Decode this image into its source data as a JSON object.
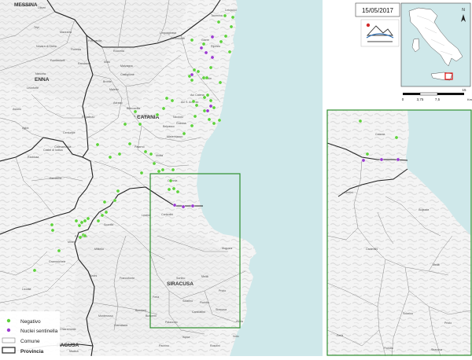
{
  "date": "15/05/2017",
  "provinces": [
    "MESSINA",
    "ENNA",
    "CATANIA",
    "SIRACUSA",
    "RAGUSA"
  ],
  "scalebar": {
    "ticks": [
      "0",
      "3,75",
      "7,5",
      "15"
    ],
    "unit": "Km"
  },
  "legend": {
    "negativo": "Negativo",
    "nuclei": "Nuclei sentinella",
    "comune": "Comune",
    "provincia": "Provincia"
  },
  "colors": {
    "negativo": "#5ed13c",
    "nuclei": "#9b3bd1",
    "sea": "#cfe8ea",
    "frame": "#2f8f2f",
    "province_border": "#222222",
    "comune_border": "#777777",
    "inset_highlight": "#e01010"
  },
  "icons": [
    "north-arrow-icon",
    "logo-icon"
  ],
  "main_points": {
    "negativo": [
      [
        286,
        20
      ],
      [
        296,
        22
      ],
      [
        278,
        28
      ],
      [
        294,
        34
      ],
      [
        287,
        46
      ],
      [
        281,
        53
      ],
      [
        292,
        66
      ],
      [
        244,
        51
      ],
      [
        259,
        56
      ],
      [
        247,
        89
      ],
      [
        252,
        91
      ],
      [
        241,
        97
      ],
      [
        259,
        99
      ],
      [
        263,
        99
      ],
      [
        244,
        102
      ],
      [
        268,
        86
      ],
      [
        280,
        105
      ],
      [
        264,
        121
      ],
      [
        268,
        128
      ],
      [
        250,
        134
      ],
      [
        260,
        124
      ],
      [
        246,
        129
      ],
      [
        272,
        137
      ],
      [
        260,
        141
      ],
      [
        248,
        148
      ],
      [
        266,
        152
      ],
      [
        279,
        153
      ],
      [
        272,
        157
      ],
      [
        244,
        160
      ],
      [
        234,
        170
      ],
      [
        219,
        128
      ],
      [
        208,
        138
      ],
      [
        200,
        146
      ],
      [
        212,
        125
      ],
      [
        172,
        142
      ],
      [
        178,
        158
      ],
      [
        159,
        158
      ],
      [
        165,
        183
      ],
      [
        124,
        184
      ],
      [
        140,
        200
      ],
      [
        152,
        196
      ],
      [
        185,
        193
      ],
      [
        192,
        196
      ],
      [
        207,
        216
      ],
      [
        202,
        218
      ],
      [
        180,
        220
      ],
      [
        196,
        208
      ],
      [
        220,
        216
      ],
      [
        217,
        230
      ],
      [
        221,
        240
      ],
      [
        215,
        241
      ],
      [
        226,
        244
      ],
      [
        150,
        243
      ],
      [
        146,
        255
      ],
      [
        133,
        257
      ],
      [
        135,
        270
      ],
      [
        130,
        274
      ],
      [
        125,
        281
      ],
      [
        112,
        278
      ],
      [
        108,
        281
      ],
      [
        97,
        281
      ],
      [
        104,
        283
      ],
      [
        101,
        287
      ],
      [
        106,
        299
      ],
      [
        108,
        300
      ],
      [
        102,
        302
      ],
      [
        66,
        286
      ],
      [
        67,
        293
      ],
      [
        75,
        319
      ],
      [
        44,
        344
      ]
    ],
    "nuclei": [
      [
        256,
        61
      ],
      [
        262,
        67
      ],
      [
        270,
        47
      ],
      [
        270,
        73
      ],
      [
        244,
        95
      ],
      [
        268,
        135
      ],
      [
        264,
        141
      ],
      [
        222,
        261
      ],
      [
        233,
        263
      ],
      [
        245,
        262
      ]
    ]
  },
  "inset_points": {
    "negativo": [
      [
        458,
        154
      ],
      [
        467,
        196
      ],
      [
        504,
        175
      ]
    ],
    "nuclei": [
      [
        462,
        204
      ],
      [
        485,
        203
      ],
      [
        506,
        203
      ]
    ]
  },
  "towns": [
    [
      "Falcone",
      27,
      8
    ],
    [
      "Oliveri",
      48,
      11
    ],
    [
      "Tripi",
      43,
      36
    ],
    [
      "Mazzarrà",
      76,
      42
    ],
    [
      "Novara di Sicilia",
      46,
      60
    ],
    [
      "Fondachelli",
      64,
      78
    ],
    [
      "Francavilla",
      112,
      53
    ],
    [
      "Floresta",
      90,
      64
    ],
    [
      "Roccella",
      144,
      66
    ],
    [
      "Randazzo",
      99,
      82
    ],
    [
      "Moio",
      132,
      80
    ],
    [
      "Malvagna",
      153,
      85
    ],
    [
      "Castiglione",
      153,
      96
    ],
    [
      "Linguaglossa",
      203,
      43
    ],
    [
      "Piedimonte",
      217,
      50
    ],
    [
      "Giarre",
      256,
      52
    ],
    [
      "Riposto",
      268,
      60
    ],
    [
      "Taormina",
      268,
      21
    ],
    [
      "Letojanni",
      286,
      14
    ],
    [
      "Bronte",
      131,
      105
    ],
    [
      "Maletto",
      139,
      115
    ],
    [
      "Adrano",
      144,
      132
    ],
    [
      "Biancavilla",
      161,
      139
    ],
    [
      "S. M. Licodia",
      170,
      149
    ],
    [
      "Paterno",
      171,
      188
    ],
    [
      "Belpasso",
      207,
      162
    ],
    [
      "Nicolosi",
      220,
      150
    ],
    [
      "Misterbianco",
      212,
      175
    ],
    [
      "Catania",
      213,
      231
    ],
    [
      "Acireale",
      256,
      101
    ],
    [
      "Aci Catena",
      242,
      122
    ],
    [
      "Aci S. Antonio",
      230,
      131
    ],
    [
      "Gravina",
      224,
      158
    ],
    [
      "Motta",
      198,
      199
    ],
    [
      "Ramacca",
      63,
      228
    ],
    [
      "Castel di Iudica",
      55,
      192
    ],
    [
      "Raddusa",
      35,
      201
    ],
    [
      "Agira",
      28,
      164
    ],
    [
      "Assoro",
      16,
      140
    ],
    [
      "Leonforte",
      34,
      113
    ],
    [
      "Nissoria",
      45,
      95
    ],
    [
      "Regalbuto",
      104,
      150
    ],
    [
      "Centuripe",
      80,
      170
    ],
    [
      "Catenanuova",
      69,
      188
    ],
    [
      "Palagonia",
      95,
      302
    ],
    [
      "Mineo",
      86,
      309
    ],
    [
      "Militello",
      120,
      318
    ],
    [
      "Scordia",
      132,
      287
    ],
    [
      "Grammichele",
      62,
      334
    ],
    [
      "Licodia",
      28,
      369
    ],
    [
      "Vizzini",
      113,
      352
    ],
    [
      "Francofonte",
      152,
      355
    ],
    [
      "Lentini",
      180,
      275
    ],
    [
      "Carlentini",
      205,
      274
    ],
    [
      "Augusta",
      282,
      317
    ],
    [
      "Melilli",
      256,
      353
    ],
    [
      "Priolo",
      278,
      371
    ],
    [
      "Siracusa",
      274,
      395
    ],
    [
      "Floridia",
      254,
      386
    ],
    [
      "Solarino",
      232,
      384
    ],
    [
      "Sortino",
      224,
      355
    ],
    [
      "Ferla",
      194,
      379
    ],
    [
      "Buccheri",
      172,
      396
    ],
    [
      "Buscemi",
      185,
      403
    ],
    [
      "Palazzolo",
      210,
      411
    ],
    [
      "Canicattini",
      244,
      398
    ],
    [
      "Noto",
      296,
      429
    ],
    [
      "Avola",
      300,
      410
    ],
    [
      "Rosolini",
      267,
      441
    ],
    [
      "Pachino",
      202,
      441
    ],
    [
      "Chiaramonte",
      76,
      420
    ],
    [
      "Giarratana",
      145,
      415
    ],
    [
      "Monterosso",
      125,
      403
    ],
    [
      "Modica",
      88,
      448
    ],
    [
      "Ispica",
      232,
      430
    ]
  ]
}
